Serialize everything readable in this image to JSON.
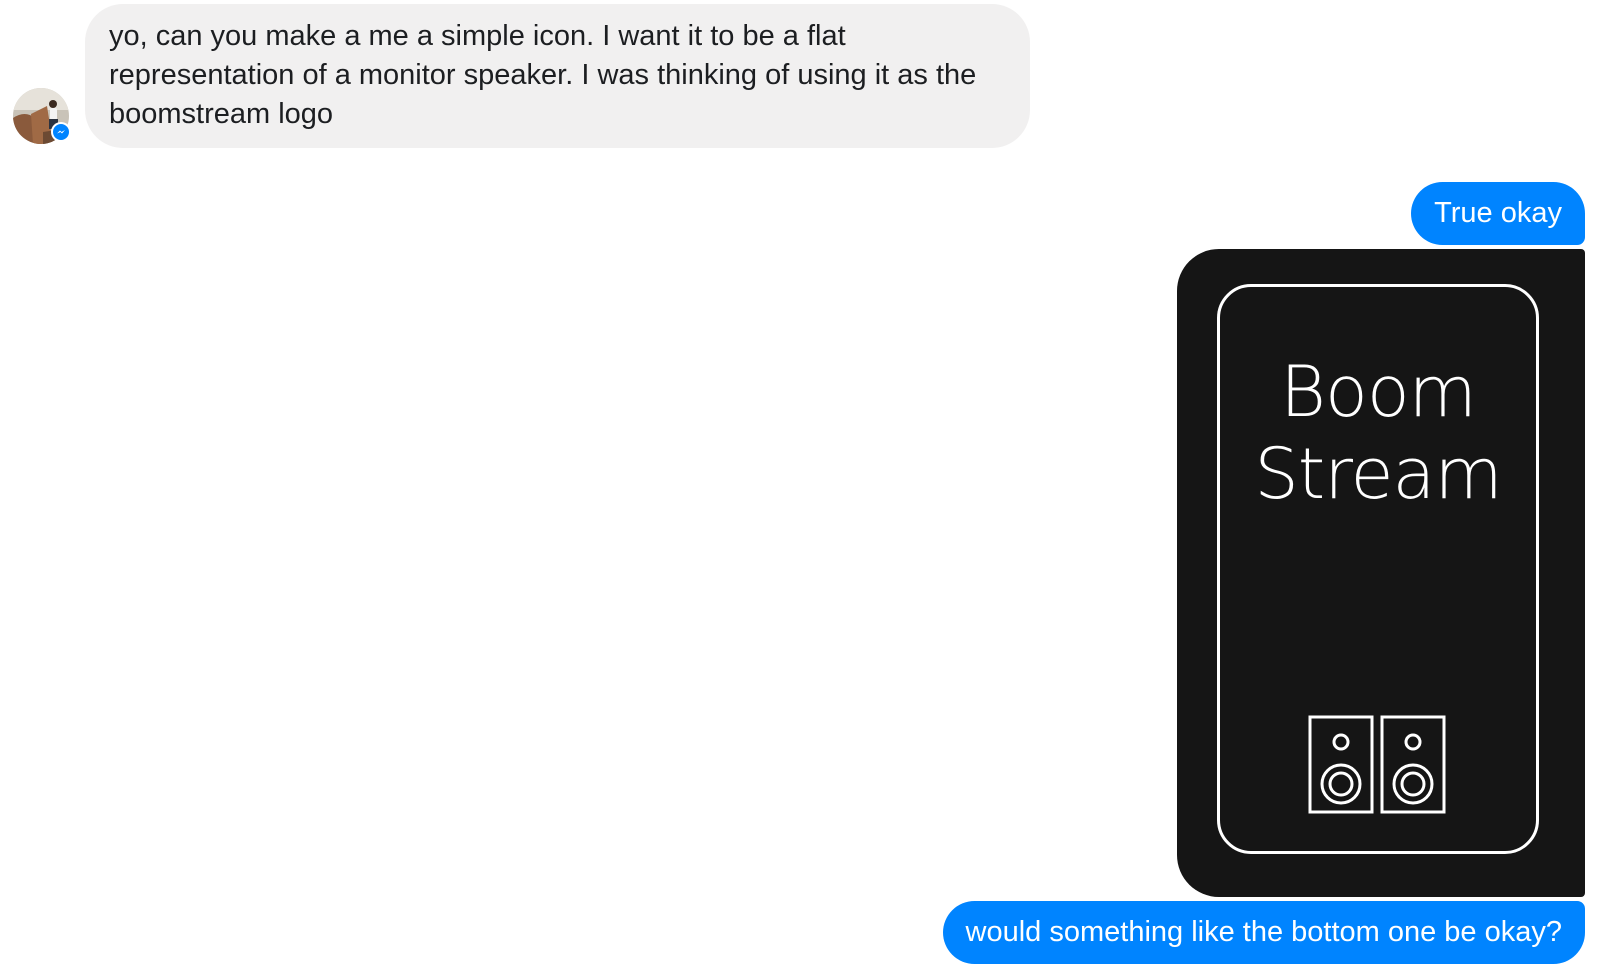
{
  "messages": [
    {
      "direction": "incoming",
      "text": "yo, can you make a me a simple icon. I want it to be a flat representation of a monitor speaker. I was thinking of using it as the boomstream logo"
    },
    {
      "direction": "outgoing",
      "text": "True okay"
    },
    {
      "direction": "outgoing",
      "type": "image",
      "image": {
        "logo_line1": "Boom",
        "logo_line2": "Stream",
        "icon": "monitor-speakers-icon"
      }
    },
    {
      "direction": "outgoing",
      "text": "would something like the bottom one be okay?"
    }
  ],
  "colors": {
    "outgoing_bubble": "#0084ff",
    "incoming_bubble": "#f1f0f0",
    "logo_background": "#151515",
    "badge": "#0084ff"
  },
  "icons": {
    "avatar": "avatar",
    "badge": "messenger-badge-icon"
  }
}
